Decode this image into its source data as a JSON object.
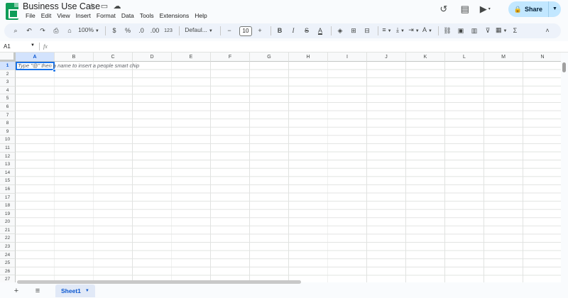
{
  "app": {
    "title": "Business Use Case",
    "menu": [
      "File",
      "Edit",
      "View",
      "Insert",
      "Format",
      "Data",
      "Tools",
      "Extensions",
      "Help"
    ]
  },
  "header": {
    "share_label": "Share"
  },
  "toolbar": {
    "zoom": "100%",
    "currency": "$",
    "percent": "%",
    "dec_decrease": ".0",
    "dec_increase": ".00",
    "number_format": "123",
    "font": "Defaul...",
    "font_size": "10",
    "bold": "B",
    "italic": "I",
    "strike": "S",
    "text_color": "A"
  },
  "formula_bar": {
    "cell_ref": "A1",
    "fx": "fx"
  },
  "grid": {
    "columns": [
      "A",
      "B",
      "C",
      "D",
      "E",
      "F",
      "G",
      "H",
      "I",
      "J",
      "K",
      "L",
      "M",
      "N"
    ],
    "rows": [
      "1",
      "2",
      "3",
      "4",
      "5",
      "6",
      "7",
      "8",
      "9",
      "10",
      "11",
      "12",
      "13",
      "14",
      "15",
      "16",
      "17",
      "18",
      "19",
      "20",
      "21",
      "22",
      "23",
      "24",
      "25",
      "26",
      "27"
    ],
    "cell_hint": "Type \"@\" then a name to insert a people smart chip"
  },
  "sheets": [
    {
      "label": "Sheet1",
      "active": true
    }
  ],
  "colors": {
    "accent": "#1a73e8",
    "share_bg": "#c2e7ff",
    "logo": "#0f9d58"
  }
}
